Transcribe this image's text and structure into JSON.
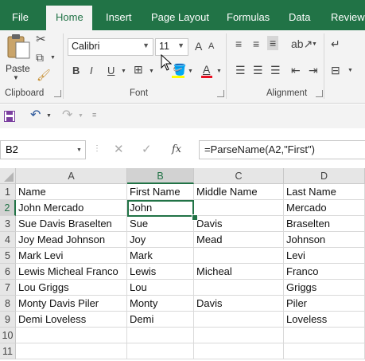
{
  "tabs": [
    {
      "label": "File",
      "active": false
    },
    {
      "label": "Home",
      "active": true
    },
    {
      "label": "Insert",
      "active": false
    },
    {
      "label": "Page Layout",
      "active": false
    },
    {
      "label": "Formulas",
      "active": false
    },
    {
      "label": "Data",
      "active": false
    },
    {
      "label": "Review",
      "active": false
    }
  ],
  "ribbon": {
    "paste_label": "Paste",
    "font_name": "Calibri",
    "font_size": "11",
    "group_clipboard": "Clipboard",
    "group_font": "Font",
    "group_alignment": "Alignment",
    "bold": "B",
    "italic": "I",
    "underline": "U",
    "grow_font": "A",
    "shrink_font": "A",
    "font_color_letter": "A",
    "font_color": "#e81123",
    "highlight_color": "#ffff00"
  },
  "formula_bar": {
    "name_box": "B2",
    "fx": "fx",
    "formula": "=ParseName(A2,\"First\")"
  },
  "grid": {
    "columns": [
      "A",
      "B",
      "C",
      "D"
    ],
    "selected_column": "B",
    "selected_row": "2",
    "rows": [
      {
        "num": "1",
        "cells": [
          "Name",
          "First Name",
          "Middle Name",
          "Last Name"
        ]
      },
      {
        "num": "2",
        "cells": [
          "John Mercado",
          "John",
          "",
          "Mercado"
        ]
      },
      {
        "num": "3",
        "cells": [
          "Sue Davis Braselten",
          "Sue",
          "Davis",
          "Braselten"
        ]
      },
      {
        "num": "4",
        "cells": [
          "Joy Mead Johnson",
          "Joy",
          "Mead",
          "Johnson"
        ]
      },
      {
        "num": "5",
        "cells": [
          "Mark Levi",
          "Mark",
          "",
          "Levi"
        ]
      },
      {
        "num": "6",
        "cells": [
          "Lewis Micheal Franco",
          "Lewis",
          "Micheal",
          "Franco"
        ]
      },
      {
        "num": "7",
        "cells": [
          "Lou Griggs",
          "Lou",
          "",
          "Griggs"
        ]
      },
      {
        "num": "8",
        "cells": [
          "Monty Davis Piler",
          "Monty",
          "Davis",
          "Piler"
        ]
      },
      {
        "num": "9",
        "cells": [
          "Demi Loveless",
          "Demi",
          "",
          "Loveless"
        ]
      },
      {
        "num": "10",
        "cells": [
          "",
          "",
          "",
          ""
        ]
      },
      {
        "num": "11",
        "cells": [
          "",
          "",
          "",
          ""
        ]
      }
    ]
  },
  "colors": {
    "accent": "#217346",
    "ribbon_bg": "#f3f3f3"
  }
}
